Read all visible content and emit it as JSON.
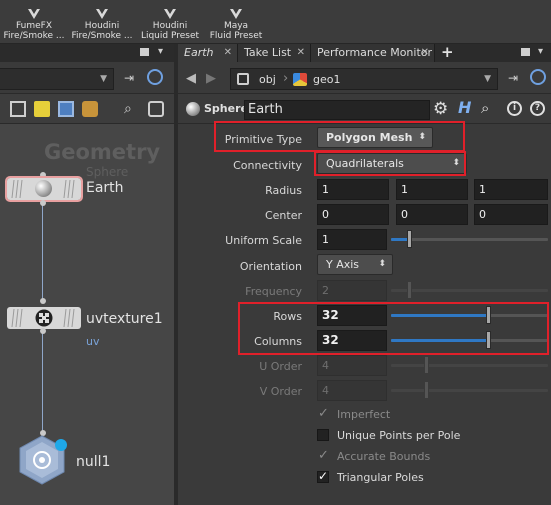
{
  "shelf": {
    "tools": [
      {
        "line1": "FumeFX",
        "line2": "Fire/Smoke ..."
      },
      {
        "line1": "Houdini",
        "line2": "Fire/Smoke ..."
      },
      {
        "line1": "Houdini",
        "line2": "Liquid Preset"
      },
      {
        "line1": "Maya",
        "line2": "Fluid Preset"
      }
    ]
  },
  "network": {
    "context_title": "Geometry",
    "context_subtitle": "Sphere",
    "nodes": [
      {
        "name": "Earth",
        "sub": ""
      },
      {
        "name": "uvtexture1",
        "sub": "uv"
      },
      {
        "name": "null1",
        "sub": ""
      }
    ]
  },
  "tabs": [
    {
      "label": "Earth"
    },
    {
      "label": "Take List"
    },
    {
      "label": "Performance Monitor"
    }
  ],
  "add_tab_glyph": "+",
  "path": {
    "root": "obj",
    "current": "geo1"
  },
  "param_header": {
    "node_type": "Sphere",
    "node_name": "Earth"
  },
  "params": {
    "primitive_type": {
      "label": "Primitive Type",
      "value": "Polygon Mesh"
    },
    "connectivity": {
      "label": "Connectivity",
      "value": "Quadrilaterals"
    },
    "radius": {
      "label": "Radius",
      "values": [
        "1",
        "1",
        "1"
      ]
    },
    "center": {
      "label": "Center",
      "values": [
        "0",
        "0",
        "0"
      ]
    },
    "uniform_scale": {
      "label": "Uniform Scale",
      "value": "1"
    },
    "orientation": {
      "label": "Orientation",
      "value": "Y Axis"
    },
    "frequency": {
      "label": "Frequency",
      "value": "2"
    },
    "rows": {
      "label": "Rows",
      "value": "32"
    },
    "columns": {
      "label": "Columns",
      "value": "32"
    },
    "u_order": {
      "label": "U Order",
      "value": "4"
    },
    "v_order": {
      "label": "V Order",
      "value": "4"
    },
    "imperfect": {
      "label": "Imperfect",
      "checked": true,
      "enabled": false
    },
    "unique_points": {
      "label": "Unique Points per Pole",
      "checked": false,
      "enabled": true
    },
    "accurate_bounds": {
      "label": "Accurate Bounds",
      "checked": true,
      "enabled": false
    },
    "triangular_poles": {
      "label": "Triangular Poles",
      "checked": true,
      "enabled": true
    }
  },
  "colors": {
    "highlight": "#e0202a",
    "slider_fill": "#2f78c4",
    "wire": "#8fa6c8",
    "node_sub": "#7aa3d8"
  }
}
